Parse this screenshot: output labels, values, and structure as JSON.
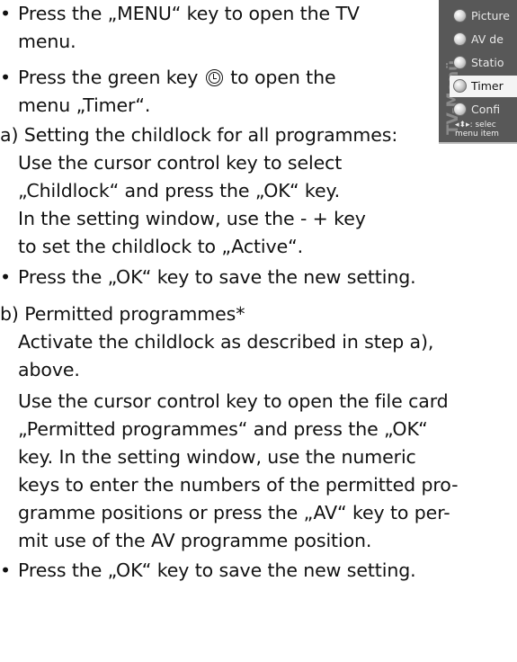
{
  "instructions": {
    "l1": "Press the „MENU“ key to open the TV",
    "l2": "menu.",
    "l3": "Press the green key",
    "l4": "to open the",
    "l5": "menu „Timer“.",
    "l6": "a) Setting the childlock for all programmes:",
    "l7": "Use the cursor control key to select",
    "l8": "„Childlock“ and press the „OK“ key.",
    "l9": "In the setting window, use the - + key",
    "l10": "to set the childlock to „Active“.",
    "l11": "Press the „OK“ key to save the new setting.",
    "l12": "b) Permitted programmes*",
    "l13": "Activate the childlock as described in step a),",
    "l14": "above.",
    "l15": "Use the cursor control key to open the file card",
    "l16": "„Permitted programmes“ and press the „OK“",
    "l17": "key. In the setting window, use the numeric",
    "l18": "keys to enter the numbers of the permitted pro-",
    "l19": "gramme positions or press the „AV“ key to per-",
    "l20": "mit use of the AV programme position.",
    "l21": "Press the „OK“ key to save the new setting."
  },
  "bullet": "•",
  "green_key_icon": "clock-icon",
  "tv_menu": {
    "title": "TV-Menü",
    "items": [
      {
        "label": "Picture",
        "selected": false
      },
      {
        "label": "AV de",
        "selected": false
      },
      {
        "label": "Statio",
        "selected": false
      },
      {
        "label": "Timer",
        "selected": true
      },
      {
        "label": "Confi",
        "selected": false
      }
    ],
    "hint_line1": "◂⬍▸: selec",
    "hint_line2": "menu item"
  },
  "colors": {
    "panel_bg": "#585858",
    "selected_bg": "#f4f4f4",
    "text": "#111111"
  }
}
